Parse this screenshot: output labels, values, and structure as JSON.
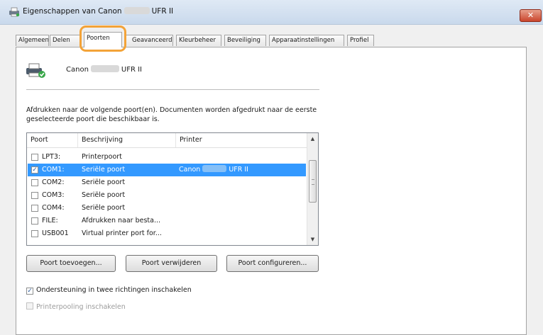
{
  "window": {
    "title": "Eigenschappen van Canon",
    "title_suffix": "UFR II"
  },
  "tabs": [
    "Algemeen",
    "Delen",
    "Poorten",
    "Geavanceerd",
    "Kleurbeheer",
    "Beveiliging",
    "Apparaatinstellingen",
    "Profiel"
  ],
  "active_tab": "Poorten",
  "printer": {
    "brand": "Canon",
    "suffix": "UFR II"
  },
  "description": "Afdrukken naar de volgende poort(en). Documenten worden afgedrukt naar de eerste geselecteerde poort die beschikbaar is.",
  "ports_table": {
    "columns": [
      "Poort",
      "Beschrijving",
      "Printer"
    ],
    "rows": [
      {
        "port": "LPT3:",
        "description": "Printerpoort",
        "printer": "",
        "checked": false,
        "selected": false
      },
      {
        "port": "COM1:",
        "description": "Seriële poort",
        "printer": "Canon",
        "printer_suffix": "UFR II",
        "checked": true,
        "selected": true
      },
      {
        "port": "COM2:",
        "description": "Seriële poort",
        "printer": "",
        "checked": false,
        "selected": false
      },
      {
        "port": "COM3:",
        "description": "Seriële poort",
        "printer": "",
        "checked": false,
        "selected": false
      },
      {
        "port": "COM4:",
        "description": "Seriële poort",
        "printer": "",
        "checked": false,
        "selected": false
      },
      {
        "port": "FILE:",
        "description": "Afdrukken naar besta...",
        "printer": "",
        "checked": false,
        "selected": false
      },
      {
        "port": "USB001",
        "description": "Virtual printer port for...",
        "printer": "",
        "checked": false,
        "selected": false
      }
    ]
  },
  "buttons": {
    "add_port": "Poort toevoegen...",
    "remove_port": "Poort verwijderen",
    "configure_port": "Poort configureren..."
  },
  "options": {
    "bidirectional": {
      "label": "Ondersteuning in twee richtingen inschakelen",
      "checked": true,
      "enabled": true
    },
    "pooling": {
      "label": "Printerpooling inschakelen",
      "checked": false,
      "enabled": false
    }
  },
  "colors": {
    "highlight": "#f3a338",
    "selection": "#3399ff",
    "close_button": "#c9452c"
  },
  "icons": {
    "title": "printer-icon",
    "close": "close-icon",
    "printer": "printer-icon",
    "check": "check-icon"
  }
}
